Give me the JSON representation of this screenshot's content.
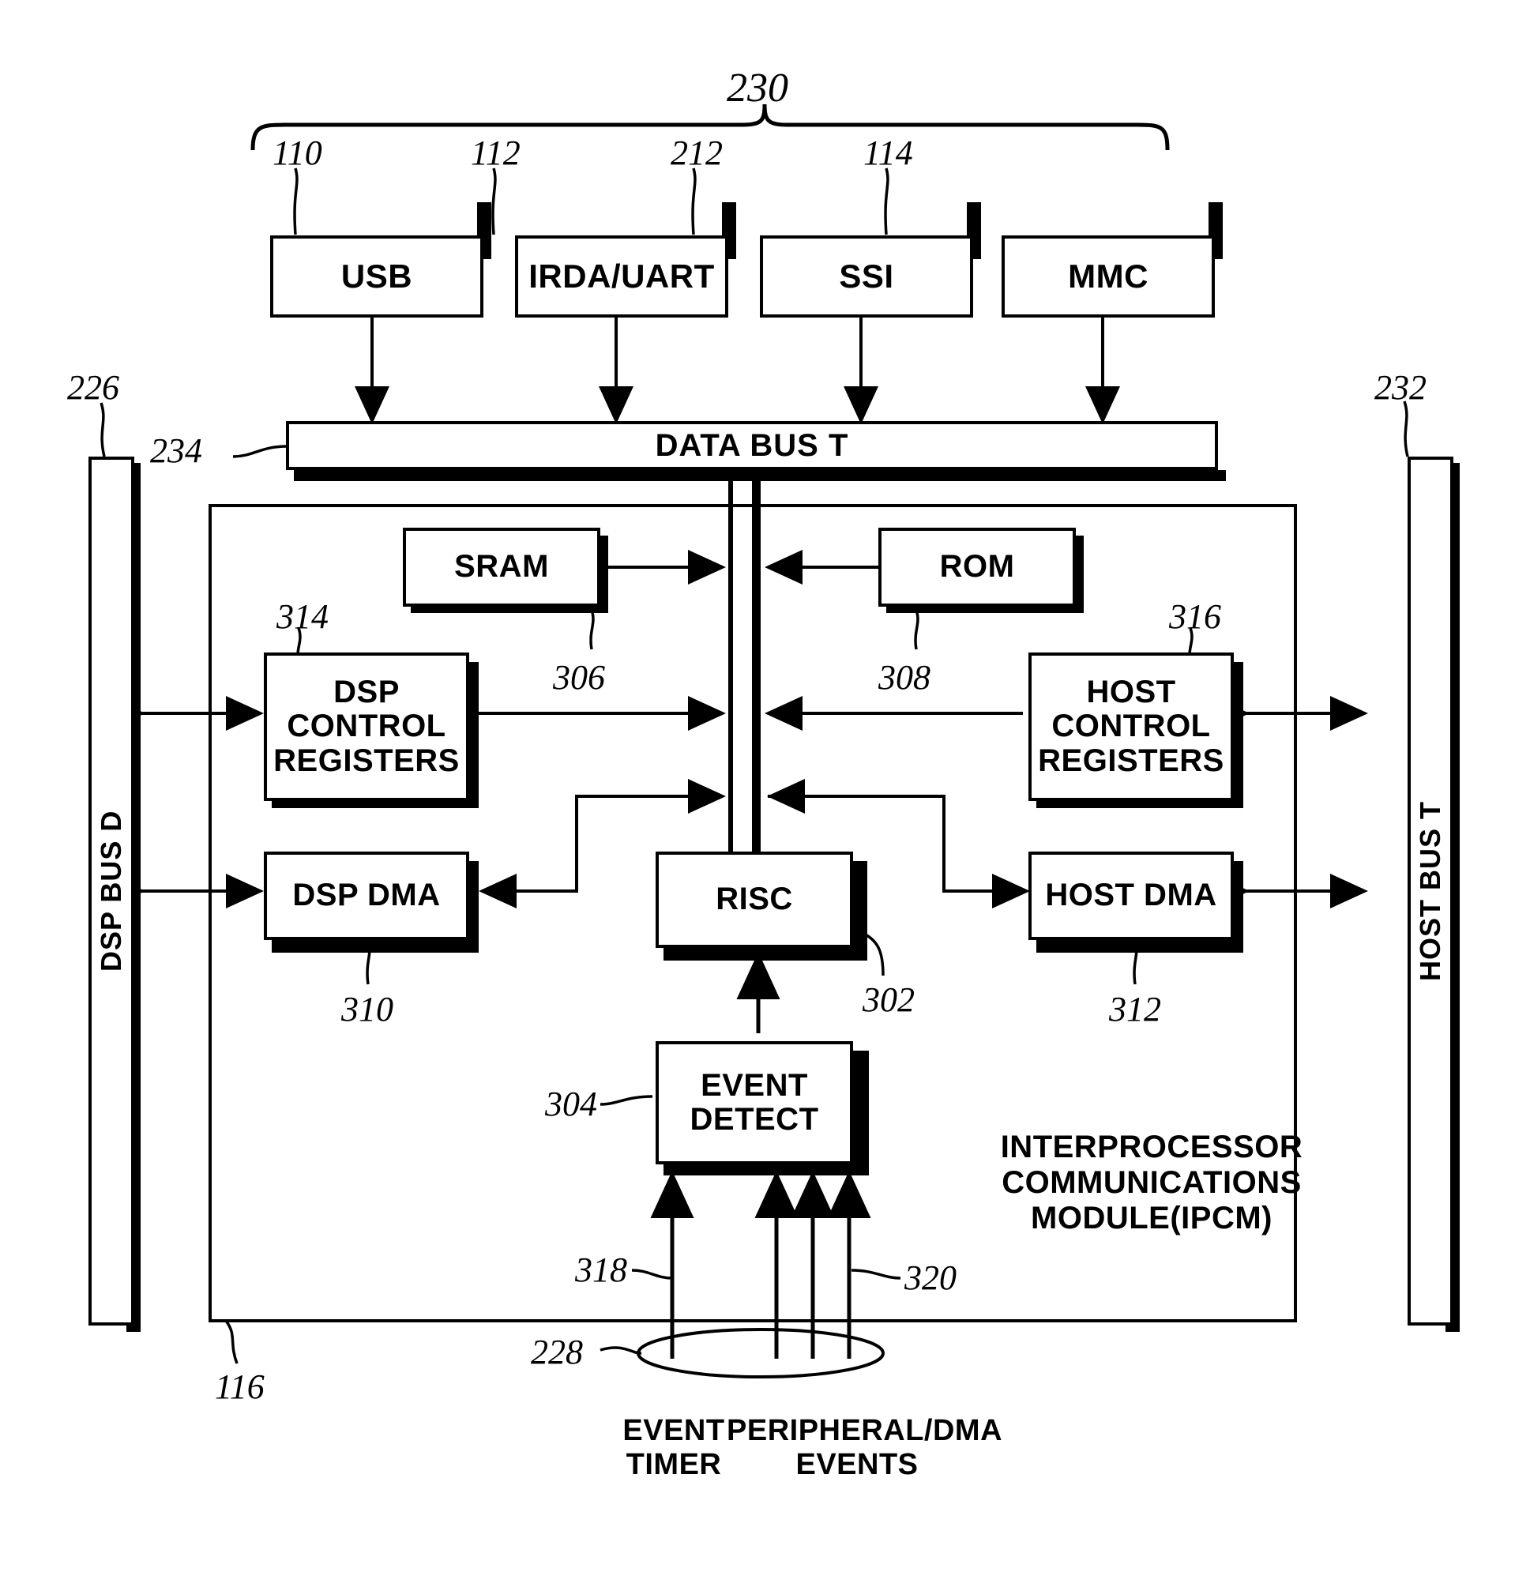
{
  "figure": {
    "type": "patent-block-diagram",
    "title": "Interprocessor Communications Module block diagram"
  },
  "peripherals": {
    "group_ref": "230",
    "items": [
      {
        "label": "USB",
        "ref": "110"
      },
      {
        "label": "IRDA/UART",
        "ref": "112"
      },
      {
        "label": "SSI",
        "ref": "212"
      },
      {
        "label": "MMC",
        "ref": "114"
      }
    ]
  },
  "buses": {
    "data_bus": {
      "label": "DATA BUS T",
      "ref": "234"
    },
    "dsp_bus": {
      "label": "DSP BUS D",
      "ref": "226"
    },
    "host_bus": {
      "label": "HOST BUS T",
      "ref": "232"
    }
  },
  "ipcm": {
    "ref": "116",
    "caption": "INTERPROCESSOR\nCOMMUNICATIONS\nMODULE(IPCM)",
    "blocks": [
      {
        "label": "SRAM",
        "ref": "306"
      },
      {
        "label": "ROM",
        "ref": "308"
      },
      {
        "label": "DSP\nCONTROL\nREGISTERS",
        "ref": "314"
      },
      {
        "label": "HOST\nCONTROL\nREGISTERS",
        "ref": "316"
      },
      {
        "label": "DSP DMA",
        "ref": "310"
      },
      {
        "label": "HOST DMA",
        "ref": "312"
      },
      {
        "label": "RISC",
        "ref": "302"
      },
      {
        "label": "EVENT\nDETECT",
        "ref": "304"
      }
    ]
  },
  "events": {
    "bundle_ref": "228",
    "timer_ref": "318",
    "peripheral_ref": "320",
    "timer_label": "EVENT\nTIMER",
    "peripheral_label": "PERIPHERAL/DMA\nEVENTS"
  },
  "colors": {
    "ink": "#000000",
    "paper": "#ffffff"
  }
}
